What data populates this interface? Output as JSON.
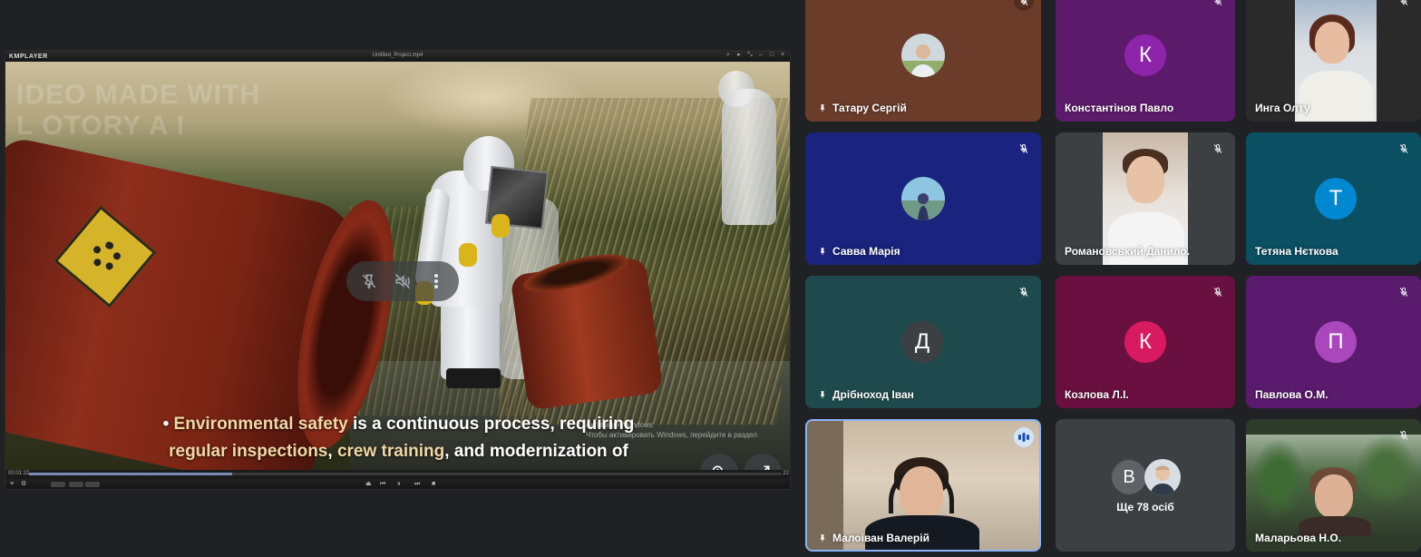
{
  "player": {
    "app_name": "KMPLAYER",
    "file_name": "Untitled_Project.mp4",
    "watermark_line1": "IDEO MADE WITH",
    "watermark_line2": "L  OTORY A I",
    "subtitle": {
      "bullet": "•",
      "l1_hl1": "Environmental safety",
      "l1_rest": " is a continuous process, requiring",
      "l2_hl1": "regular inspections",
      "l2_sep": ", ",
      "l2_hl2": "crew training",
      "l2_rest": ", and modernization of"
    },
    "activate_windows_line1": "Активация Windows",
    "activate_windows_line2": "Чтобы активировать Windows, перейдите в раздел",
    "time_current": "00:01:22",
    "time_total": "22",
    "progress_fraction": 0.27
  },
  "colors": {
    "hazard": "#d6b42a",
    "subtitle_highlight": "#f1d7a5",
    "active_speaker_border": "#8ab4f8"
  },
  "tiles": {
    "tataru": {
      "name": "Татару Сергій",
      "bg": "#6b3c2a"
    },
    "konstantinov": {
      "name": "Константінов Павло",
      "initial": "К",
      "bg": "#5c1a6b",
      "avatar_bg": "#8e24aa"
    },
    "olt": {
      "name": "Инга Олту",
      "bg": "#2a2a2a"
    },
    "savva": {
      "name": "Савва Марія",
      "bg": "#1a237e"
    },
    "romanovskyi": {
      "name": "Романовський Данило.",
      "bg": "#3c4043"
    },
    "netkova": {
      "name": "Тетяна Нєткова",
      "initial": "Т",
      "bg": "#0b4f63",
      "avatar_bg": "#0288d1"
    },
    "dribnokhod": {
      "name": "Дрібноход Іван",
      "initial": "Д",
      "bg": "#1f4a4d",
      "avatar_bg": "#3c4043"
    },
    "kozlova": {
      "name": "Козлова Л.І.",
      "initial": "К",
      "bg": "#6a1040",
      "avatar_bg": "#d81b60"
    },
    "pavlova": {
      "name": "Павлова О.М.",
      "initial": "П",
      "bg": "#5a1a6e",
      "avatar_bg": "#ab47bc"
    },
    "maloivan": {
      "name": "Малоіван Валерій",
      "bg": "#4a4440"
    },
    "others": {
      "initial": "В",
      "label": "Ще 78 осіб",
      "bg": "#3c4043",
      "avatar_bg": "#5f6368"
    },
    "malaryova": {
      "name": "Маларьова Н.О.",
      "bg": "#2e3b2a"
    }
  }
}
